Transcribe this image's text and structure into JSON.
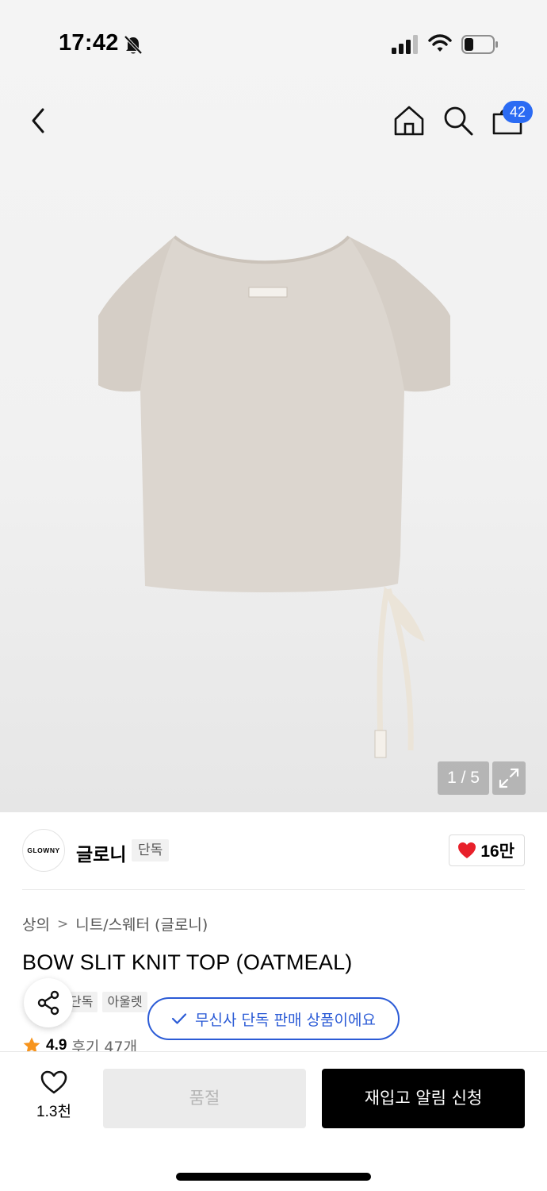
{
  "status_bar": {
    "time": "17:42"
  },
  "header": {
    "cart_count": "42"
  },
  "gallery": {
    "page_indicator": "1 / 5"
  },
  "brand": {
    "logo_text": "GLOWNY",
    "name": "글로니",
    "tag": "단독",
    "likes": "16만"
  },
  "breadcrumb": {
    "category": "상의",
    "subcategory": "니트/스웨터 (글로니)"
  },
  "product": {
    "title": "BOW SLIT KNIT TOP (OATMEAL)",
    "tags": [
      "단독",
      "아울렛"
    ],
    "rating": "4.9",
    "reviews": "후기 47개",
    "exclusive_notice": "무신사 단독 판매 상품이에요"
  },
  "actions": {
    "wish_count": "1.3천",
    "soldout_label": "품절",
    "restock_label": "재입고 알림 신청"
  },
  "colors": {
    "accent_blue": "#2b5bd6",
    "heart_red": "#e8202a",
    "star_orange": "#f7941d"
  },
  "icons": [
    "chevron-left-icon",
    "home-icon",
    "search-icon",
    "shopping-bag-icon",
    "expand-icon",
    "heart-icon",
    "share-icon",
    "check-icon",
    "star-icon",
    "bell-off-icon",
    "signal-icon",
    "wifi-icon",
    "battery-icon"
  ]
}
